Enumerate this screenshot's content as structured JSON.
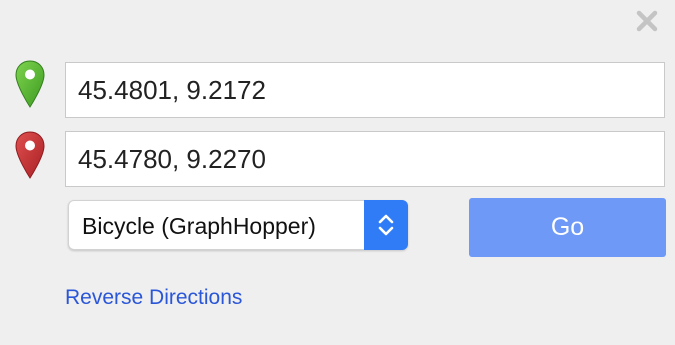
{
  "icons": {
    "close": "close-icon",
    "start_marker": "green-map-pin-icon",
    "end_marker": "red-map-pin-icon",
    "select_stepper": "chevron-up-down-icon"
  },
  "colors": {
    "start_marker": "#4cae2c",
    "end_marker": "#c9272c",
    "go_button": "#6e99f7",
    "link": "#2a56d8",
    "select_stepper": "#2f7cf6"
  },
  "route": {
    "from_value": "45.4801, 9.2172",
    "to_value": "45.4780, 9.2270"
  },
  "mode_select": {
    "selected": "Bicycle (GraphHopper)"
  },
  "actions": {
    "go_label": "Go",
    "reverse_label": "Reverse Directions"
  }
}
